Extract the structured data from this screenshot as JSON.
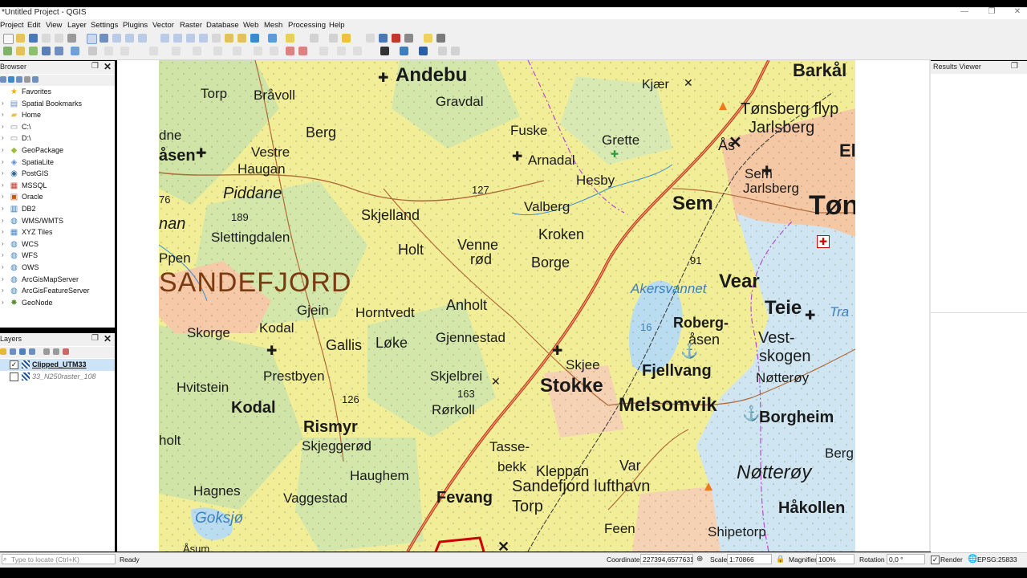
{
  "window": {
    "title": "*Untitled Project - QGIS",
    "minimize": "—",
    "maximize": "❐",
    "close": "✕"
  },
  "menu": [
    "Project",
    "Edit",
    "View",
    "Layer",
    "Settings",
    "Plugins",
    "Vector",
    "Raster",
    "Database",
    "Web",
    "Mesh",
    "Processing",
    "Help"
  ],
  "browser": {
    "title": "Browser",
    "items": [
      {
        "label": "Favorites",
        "icon": "star-icon",
        "color": "#e8b400"
      },
      {
        "label": "Spatial Bookmarks",
        "icon": "bookmark-icon",
        "color": "#6a8fc6"
      },
      {
        "label": "Home",
        "icon": "folder-icon",
        "color": "#e3c15c"
      },
      {
        "label": "C:\\",
        "icon": "drive-icon",
        "color": "#888888"
      },
      {
        "label": "D:\\",
        "icon": "drive-icon",
        "color": "#888888"
      },
      {
        "label": "GeoPackage",
        "icon": "geopackage-icon",
        "color": "#9bbf3a"
      },
      {
        "label": "SpatiaLite",
        "icon": "spatialite-icon",
        "color": "#5a8fd0"
      },
      {
        "label": "PostGIS",
        "icon": "postgis-icon",
        "color": "#336791"
      },
      {
        "label": "MSSQL",
        "icon": "mssql-icon",
        "color": "#c0392b"
      },
      {
        "label": "Oracle",
        "icon": "oracle-icon",
        "color": "#d35400"
      },
      {
        "label": "DB2",
        "icon": "db2-icon",
        "color": "#2a6ebb"
      },
      {
        "label": "WMS/WMTS",
        "icon": "globe-icon",
        "color": "#3f7fbf"
      },
      {
        "label": "XYZ Tiles",
        "icon": "tiles-icon",
        "color": "#4a8ac9"
      },
      {
        "label": "WCS",
        "icon": "globe-icon",
        "color": "#3f7fbf"
      },
      {
        "label": "WFS",
        "icon": "globe-icon",
        "color": "#3f7fbf"
      },
      {
        "label": "OWS",
        "icon": "globe-icon",
        "color": "#3f7fbf"
      },
      {
        "label": "ArcGisMapServer",
        "icon": "arcgis-icon",
        "color": "#3f7fbf"
      },
      {
        "label": "ArcGisFeatureServer",
        "icon": "arcgis-icon",
        "color": "#3f7fbf"
      },
      {
        "label": "GeoNode",
        "icon": "geonode-icon",
        "color": "#5b8d2f"
      }
    ]
  },
  "layers": {
    "title": "Layers",
    "items": [
      {
        "label": "Clipped_UTM33",
        "checked": true
      },
      {
        "label": "33_N250raster_108",
        "checked": false
      }
    ]
  },
  "results_viewer": {
    "title": "Results Viewer"
  },
  "map_labels": [
    "Andebu",
    "Barkål",
    "Torp",
    "Bråvoll",
    "Gravdal",
    "Kjær",
    "Tønsberg flyp",
    "Jarlsberg",
    "Ås",
    "Fuske",
    "Grette",
    "Arnadal",
    "Berg",
    "Vestre",
    "Haugan",
    "Hesby",
    "Sem",
    "Jarlsberg",
    "Sem",
    "Tøn",
    "Piddane",
    "Valberg",
    "Skjelland",
    "Kroken",
    "Slettingdalen",
    "Venne",
    "rød",
    "Holt",
    "Borge",
    "SANDEFJORD",
    "Gjein",
    "Horntvedt",
    "Anholt",
    "Vear",
    "Akersvannet",
    "Roberg-",
    "åsen",
    "Teie",
    "Skorge",
    "Kodal",
    "Gallis",
    "Løke",
    "Gjennestad",
    "Vest-",
    "skogen",
    "Prestbyen",
    "Skjee",
    "Fjellvang",
    "Nøtterøy",
    "Skjelbrei",
    "Stokke",
    "Hvitstein",
    "Melsomvik",
    "Borgheim",
    "Kodal",
    "Rismyr",
    "Rørkoll",
    "Skjeggerød",
    "Tasse-",
    "bekk",
    "holt",
    "Haughem",
    "Kleppan",
    "Var",
    "Nøtterøy",
    "Hagnes",
    "Vaggestad",
    "Fevang",
    "Sandefjord lufthavn",
    "Torp",
    "Håkollen",
    "Goksjø",
    "Feen",
    "Shipetorp",
    "Berg",
    "Ppen",
    "dne",
    "åsen",
    "nan",
    "76",
    "189",
    "127",
    "91",
    "16",
    "126",
    "163",
    "Ela",
    "Tra",
    "Åsum"
  ],
  "status": {
    "locate_placeholder": "Type to locate (Ctrl+K)",
    "ready": "Ready",
    "coordinate_label": "Coordinate",
    "coordinate_value": "227394,6577631",
    "scale_label": "Scale",
    "scale_value": "1:70866",
    "magnifier_label": "Magnifier",
    "magnifier_value": "100%",
    "rotation_label": "Rotation",
    "rotation_value": "0,0 °",
    "render_label": "Render",
    "render_checked": true,
    "crs": "EPSG:25833"
  }
}
